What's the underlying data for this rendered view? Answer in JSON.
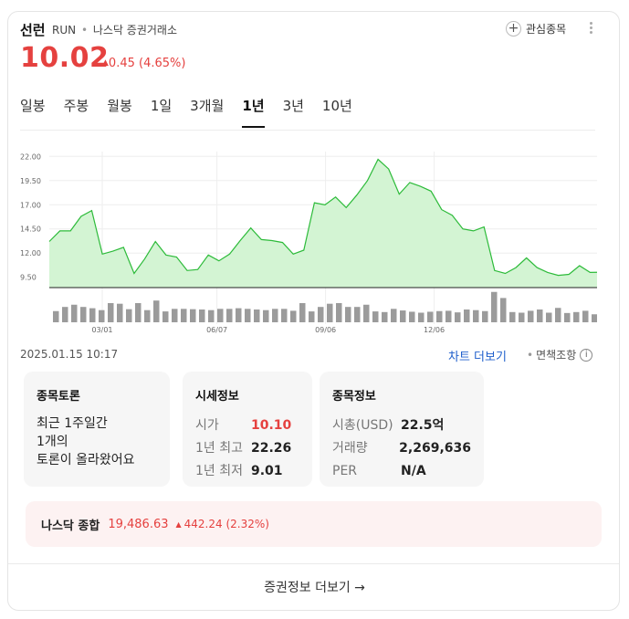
{
  "stock": {
    "name": "선런",
    "ticker": "RUN",
    "exchange": "나스닥 증권거래소",
    "price": "10.02",
    "change": "0.45",
    "change_pct": "(4.65%)",
    "up_arrow": "▲"
  },
  "watchlist": {
    "label": "관심종목",
    "icon": "plus-icon"
  },
  "tabs": [
    "일봉",
    "주봉",
    "월봉",
    "1일",
    "3개월",
    "1년",
    "3년",
    "10년"
  ],
  "active_tab": "1년",
  "chart_data": {
    "type": "area",
    "ylim": [
      9.0,
      22.5
    ],
    "y_ticks": [
      "22.00",
      "19.50",
      "17.00",
      "14.50",
      "12.00",
      "9.50"
    ],
    "x_ticks": [
      "03/01",
      "06/07",
      "09/06",
      "12/06"
    ],
    "y_tick_values": [
      22.0,
      19.5,
      17.0,
      14.5,
      12.0,
      9.5
    ],
    "x_tick_positions": [
      9.6,
      30.4,
      50.1,
      69.8
    ],
    "values": [
      13.2,
      14.3,
      14.3,
      15.8,
      16.4,
      11.9,
      12.2,
      12.6,
      9.9,
      11.4,
      13.2,
      11.8,
      11.6,
      10.2,
      10.3,
      11.8,
      11.2,
      11.9,
      13.3,
      14.6,
      13.4,
      13.3,
      13.1,
      11.9,
      12.3,
      17.2,
      17.0,
      17.8,
      16.7,
      18.0,
      19.5,
      21.7,
      20.7,
      18.1,
      19.3,
      18.9,
      18.4,
      16.5,
      15.9,
      14.5,
      14.3,
      14.7,
      10.2,
      9.9,
      10.5,
      11.5,
      10.5,
      10.0,
      9.7,
      9.8,
      10.7,
      10.0,
      10.02
    ],
    "volume": [
      0.35,
      0.48,
      0.55,
      0.48,
      0.44,
      0.38,
      0.6,
      0.58,
      0.41,
      0.6,
      0.38,
      0.68,
      0.34,
      0.42,
      0.42,
      0.41,
      0.4,
      0.38,
      0.42,
      0.42,
      0.44,
      0.42,
      0.4,
      0.38,
      0.42,
      0.42,
      0.36,
      0.6,
      0.34,
      0.48,
      0.58,
      0.6,
      0.48,
      0.48,
      0.55,
      0.34,
      0.32,
      0.42,
      0.37,
      0.33,
      0.3,
      0.33,
      0.35,
      0.36,
      0.31,
      0.4,
      0.38,
      0.35,
      0.95,
      0.76,
      0.32,
      0.3,
      0.36,
      0.4,
      0.3,
      0.45,
      0.29,
      0.32,
      0.36,
      0.25
    ],
    "line_color": "#2dbb3a",
    "fill_color": "#d3f4d3",
    "volume_color": "#9b9b9b"
  },
  "timestamp": "2025.01.15 10:17",
  "chart_more_label": "차트 더보기",
  "disclaimer_label": "면책조항",
  "discussion": {
    "title": "종목토론",
    "lines": [
      "최근 1주일간",
      "1개의",
      "토론이 올라왔어요"
    ]
  },
  "market_info": {
    "title": "시세정보",
    "rows": [
      {
        "label": "시가",
        "value": "10.10"
      },
      {
        "label": "1년 최고",
        "value": "22.26"
      },
      {
        "label": "1년 최저",
        "value": "9.01"
      }
    ]
  },
  "stock_info": {
    "title": "종목정보",
    "rows": [
      {
        "label": "시총(USD)",
        "value": "22.5억"
      },
      {
        "label": "거래량",
        "value": "2,269,636"
      },
      {
        "label": "PER",
        "value": "N/A"
      }
    ]
  },
  "index": {
    "name": "나스닥 종합",
    "value": "19,486.63",
    "change": "442.24",
    "change_pct": "(2.32%)"
  },
  "footer": {
    "label": "증권정보 더보기 →"
  },
  "colors": {
    "up": "#e5413f",
    "link": "#1f5fcc"
  }
}
